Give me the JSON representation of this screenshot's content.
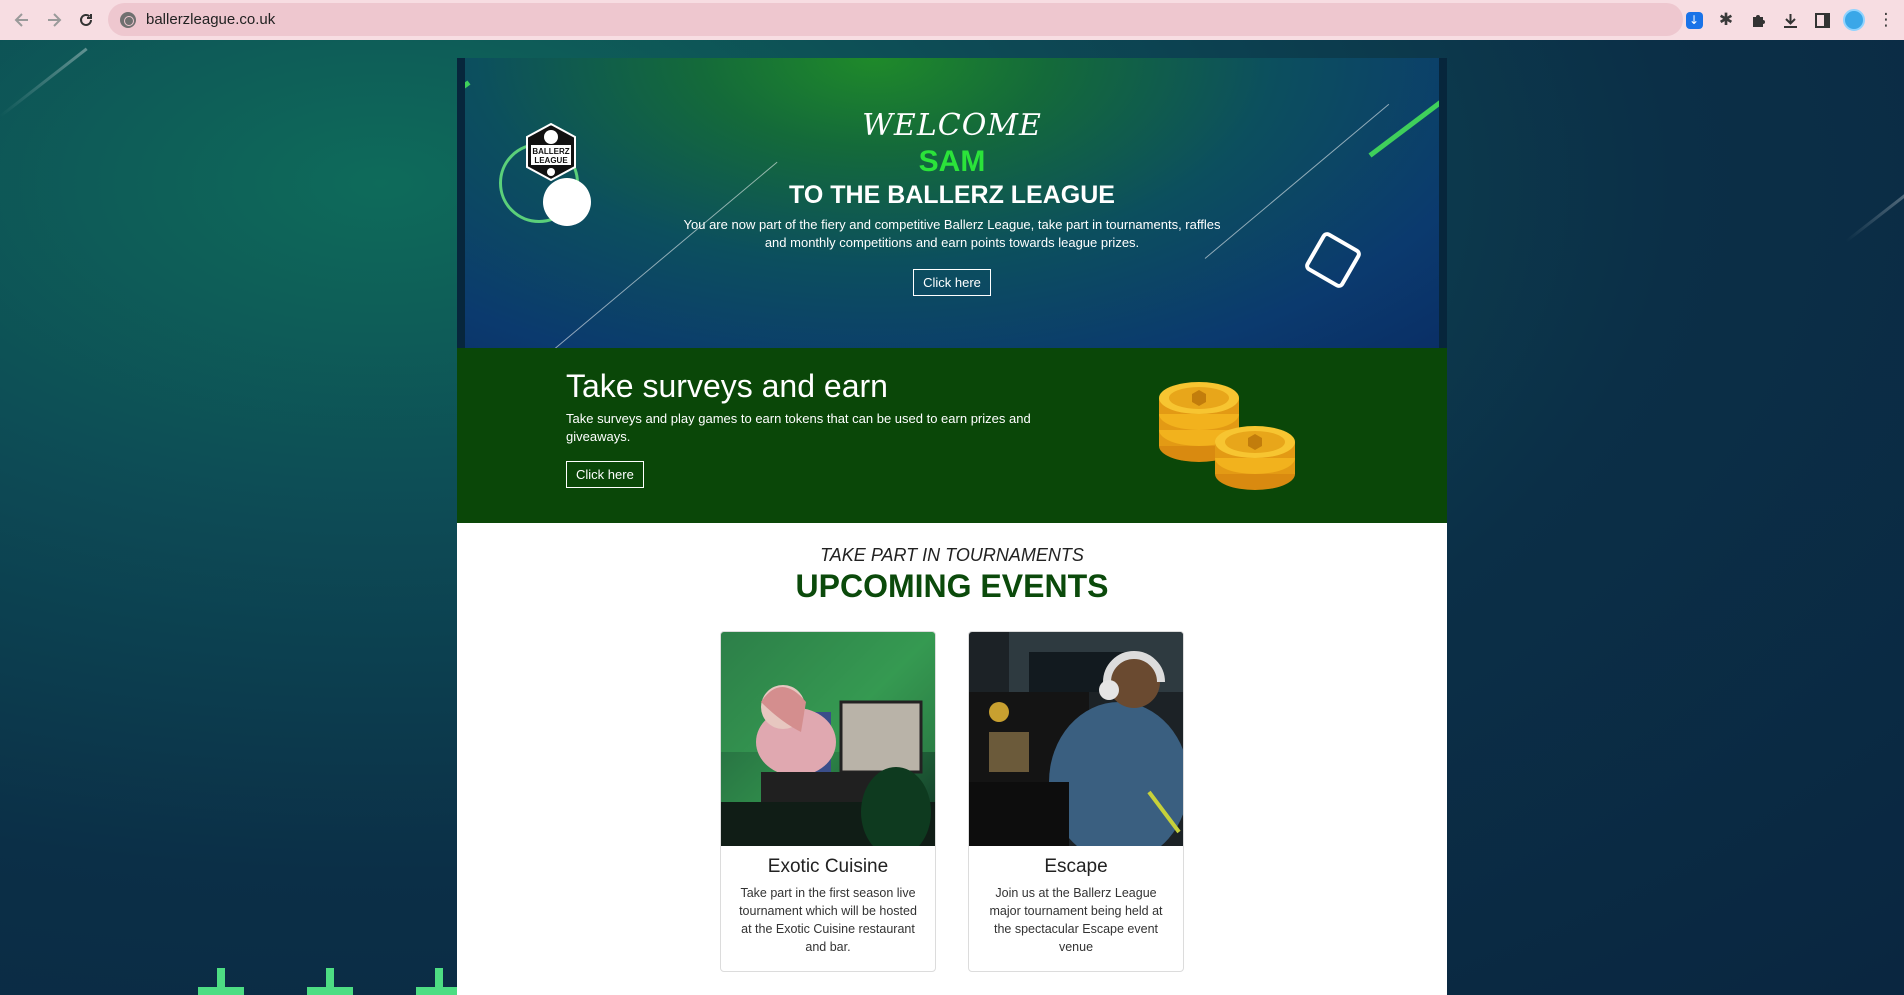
{
  "browser": {
    "url": "ballerzleague.co.uk"
  },
  "hero": {
    "welcome": "WELCOME",
    "name": "SAM",
    "title": "TO THE BALLERZ LEAGUE",
    "description": "You are now part of the fiery and competitive Ballerz League, take part in tournaments, raffles and monthly competitions and earn points towards league prizes.",
    "button_label": "Click here",
    "logo_text_1": "BALLERZ",
    "logo_text_2": "LEAGUE"
  },
  "surveys": {
    "title": "Take surveys and earn",
    "description": "Take surveys and play games to earn tokens that can be used to earn prizes and giveaways.",
    "button_label": "Click here"
  },
  "events": {
    "kicker": "TAKE PART IN TOURNAMENTS",
    "title": "UPCOMING EVENTS",
    "cards": [
      {
        "title": "Exotic Cuisine",
        "description": "Take part in the first season live tournament which will be hosted at the Exotic Cuisine restaurant and bar."
      },
      {
        "title": "Escape",
        "description": "Join us at the Ballerz League major tournament being held at the spectacular Escape event venue"
      }
    ]
  },
  "colors": {
    "accent_green": "#2be33a",
    "surveys_bg": "#0a4708",
    "events_title": "#0b4a0b"
  }
}
